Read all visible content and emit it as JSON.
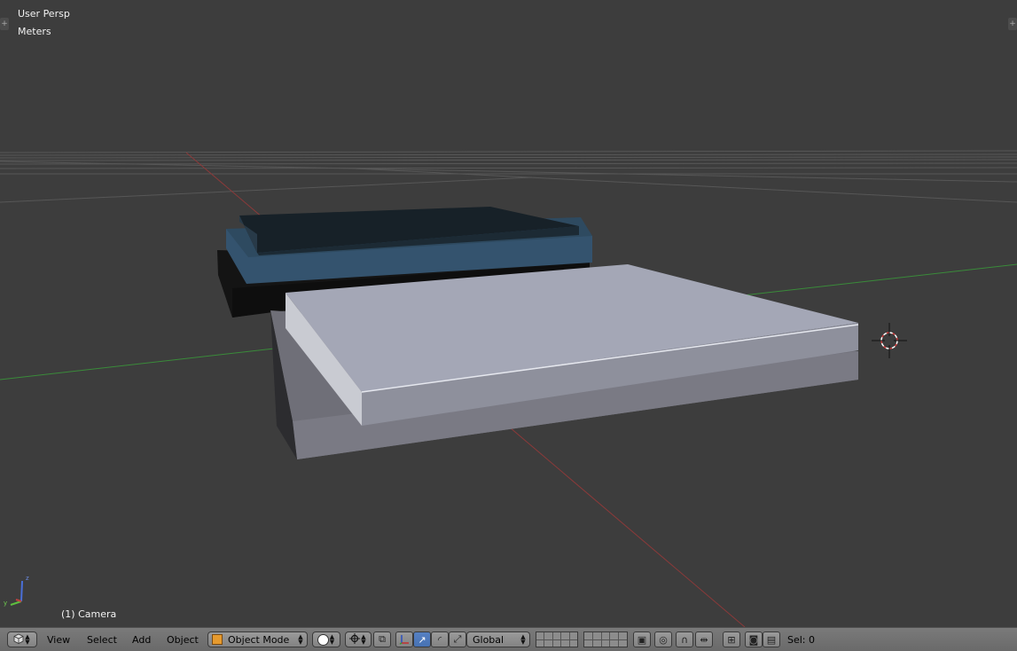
{
  "viewport": {
    "view_label": "User Persp",
    "units_label": "Meters",
    "object_info": "(1) Camera",
    "colors": {
      "background": "#3d3d3d",
      "grid": "#555555",
      "x_axis": "#8b3a3a",
      "y_axis": "#3a8b3a"
    },
    "axes_widget": {
      "z": "z",
      "y": "y"
    }
  },
  "header": {
    "editor_type_icon": "cube-icon",
    "menus": [
      "View",
      "Select",
      "Add",
      "Object"
    ],
    "mode": "Object Mode",
    "shading_icon": "sphere-icon",
    "pivot_icon": "crosshair-icon",
    "transform_orientation": "Global",
    "selection_label": "Sel: 0"
  }
}
